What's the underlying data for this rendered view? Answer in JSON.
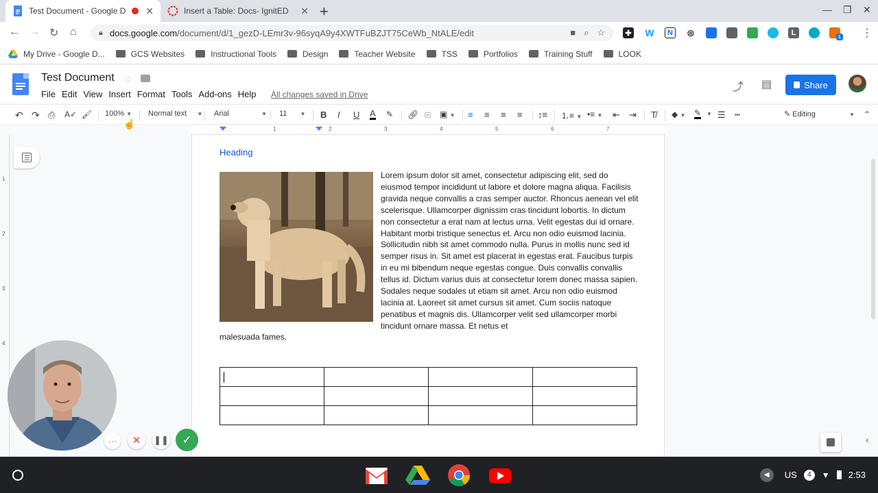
{
  "browser": {
    "tabs": [
      {
        "title": "Test Document - Google Doc",
        "active": true,
        "recording": true
      },
      {
        "title": "Insert a Table: Docs- IgnitED",
        "active": false
      }
    ],
    "url_host": "docs.google.com",
    "url_path": "/document/d/1_gezD-LEmr3v-96syqA9y4XWTFuBZJT75CeWb_NtALE/edit",
    "bookmarks": [
      "My Drive - Google D...",
      "GCS Websites",
      "Instructional Tools",
      "Design",
      "Teacher Website",
      "TSS",
      "Portfolios",
      "Training Stuff",
      "LOOK"
    ],
    "extensions": [
      "W",
      "N",
      "L"
    ]
  },
  "docs": {
    "title": "Test Document",
    "menus": [
      "File",
      "Edit",
      "View",
      "Insert",
      "Format",
      "Tools",
      "Add-ons",
      "Help"
    ],
    "save_status": "All changes saved in Drive",
    "share_label": "Share",
    "toolbar": {
      "zoom": "100%",
      "style": "Normal text",
      "font": "Arial",
      "size": "11",
      "bold": "B",
      "italic": "I",
      "underline": "U",
      "text_color": "A",
      "mode": "Editing"
    },
    "ruler_numbers": [
      "1",
      "2",
      "3",
      "4",
      "5",
      "6",
      "7"
    ],
    "vruler_numbers": [
      "1",
      "2",
      "3",
      "4"
    ]
  },
  "document": {
    "heading": "Heading",
    "body": "Lorem ipsum dolor sit amet, consectetur adipiscing elit, sed do eiusmod tempor incididunt ut labore et dolore magna aliqua. Facilisis gravida neque convallis a cras semper auctor. Rhoncus aenean vel elit scelerisque. Ullamcorper dignissim cras tincidunt lobortis. In dictum non consectetur a erat nam at lectus urna. Velit egestas dui id ornare. Habitant morbi tristique senectus et. Arcu non odio euismod lacinia. Sollicitudin nibh sit amet commodo nulla. Purus in mollis nunc sed id semper risus in. Sit amet est placerat in egestas erat. Faucibus turpis in eu mi bibendum neque egestas congue. Duis convallis convallis tellus id. Dictum varius duis at consectetur lorem donec massa sapien. Sodales neque sodales ut etiam sit amet. Arcu non odio euismod lacinia at. Laoreet sit amet cursus sit amet. Cum sociis natoque penatibus et magnis dis. Ullamcorper velit sed ullamcorper morbi tincidunt ornare massa. Et netus et",
    "body_tail": "malesuada fames.",
    "table_rows": 3,
    "table_cols": 4
  },
  "system": {
    "locale": "US",
    "time": "2:53",
    "notification_count": "1"
  },
  "colors": {
    "share_blue": "#1a73e8",
    "heading_blue": "#1155cc",
    "shelf": "#202124",
    "rec_red": "#d93025",
    "confirm_green": "#34a853"
  }
}
